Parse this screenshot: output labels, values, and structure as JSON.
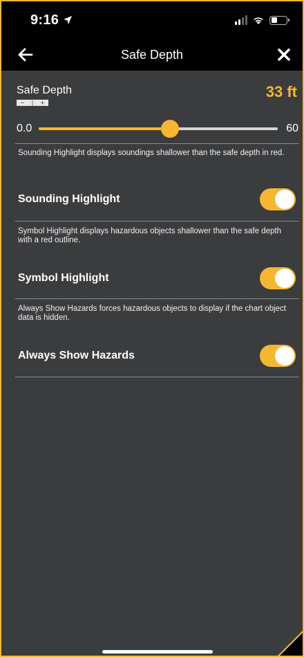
{
  "status": {
    "time": "9:16",
    "location_icon": "location-arrow-icon",
    "signal_icon": "cellular-signal-icon",
    "wifi_icon": "wifi-icon",
    "battery_icon": "battery-icon"
  },
  "nav": {
    "title": "Safe Depth",
    "back_icon": "arrow-left-icon",
    "close_icon": "close-icon"
  },
  "safe_depth": {
    "label": "Safe Depth",
    "value": "33 ft",
    "stepper_minus": "−",
    "stepper_mid": "|",
    "stepper_plus": "+",
    "slider_min": "0.0",
    "slider_max": "60",
    "slider_fraction": 0.55
  },
  "settings": [
    {
      "description": "Sounding Highlight displays soundings shallower than the safe depth in red.",
      "label": "Sounding Highlight",
      "enabled": true
    },
    {
      "description": "Symbol Highlight displays hazardous objects shallower than the safe depth with a red outline.",
      "label": "Symbol Highlight",
      "enabled": true
    },
    {
      "description": "Always Show Hazards forces hazardous objects to display if the chart object data is hidden.",
      "label": "Always Show Hazards",
      "enabled": true
    }
  ],
  "colors": {
    "accent": "#f5b731",
    "background": "#3b3c3e",
    "bar": "#000000"
  }
}
